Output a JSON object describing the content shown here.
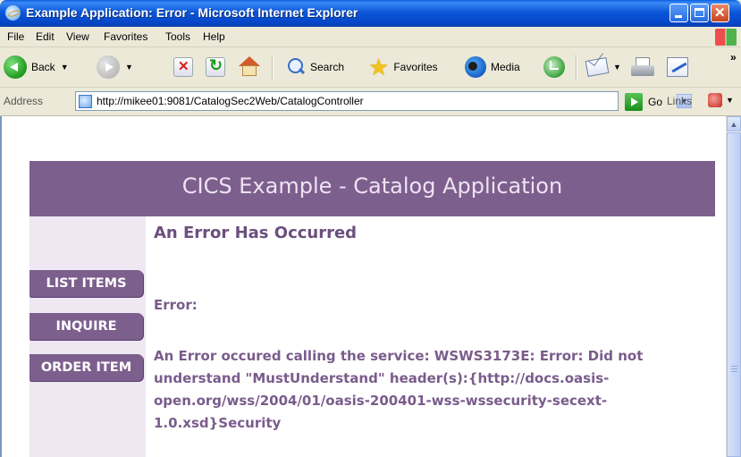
{
  "window": {
    "title": "Example Application: Error - Microsoft Internet Explorer"
  },
  "menu": [
    "File",
    "Edit",
    "View",
    "Favorites",
    "Tools",
    "Help"
  ],
  "toolbar": {
    "back_label": "Back",
    "search_label": "Search",
    "favorites_label": "Favorites",
    "media_label": "Media",
    "overflow_label": "»"
  },
  "address": {
    "label": "Address",
    "url": "http://mikee01:9081/CatalogSec2Web/CatalogController",
    "go_label": "Go",
    "links_label": "Links"
  },
  "page": {
    "header_title": "CICS Example - Catalog Application",
    "nav": [
      "LIST ITEMS",
      "INQUIRE",
      "ORDER ITEM"
    ],
    "error_title": "An Error Has Occurred",
    "error_label": "Error:",
    "error_lines": [
      "An Error occured calling the service: WSWS3173E: Error: Did not",
      "understand \"MustUnderstand\" header(s):{http://docs.oasis-",
      "open.org/wss/2004/01/oasis-200401-wss-wssecurity-secext-",
      "1.0.xsd}Security"
    ]
  },
  "colors": {
    "brand_purple": "#7d5f8e",
    "text_purple": "#7a5c8c",
    "sidebar_bg": "#efe8f3",
    "titlebar_blue": "#0b57d8"
  },
  "icons": [
    "ie-app-icon",
    "back-icon",
    "forward-icon",
    "stop-icon",
    "refresh-icon",
    "home-icon",
    "search-icon",
    "favorites-star-icon",
    "media-icon",
    "history-icon",
    "mail-icon",
    "print-icon",
    "edit-icon",
    "page-icon",
    "go-arrow-icon",
    "links-icon"
  ]
}
